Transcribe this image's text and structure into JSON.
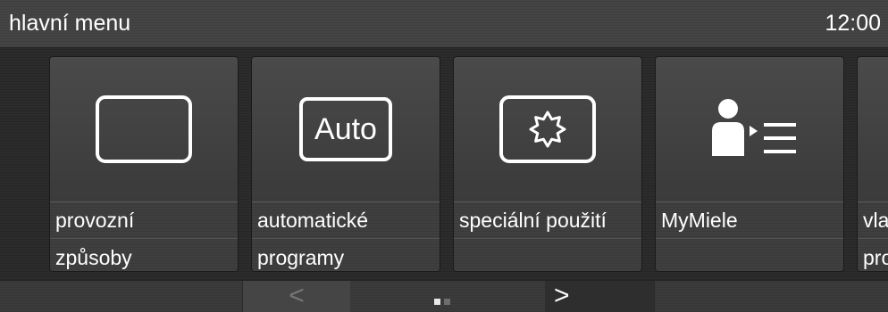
{
  "header": {
    "title": "hlavní menu",
    "clock": "12:00"
  },
  "tiles": [
    {
      "label_line1": "provozní",
      "label_line2": "způsoby",
      "icon": "blank-rectangle-icon"
    },
    {
      "label_line1": "automatické",
      "label_line2": "programy",
      "icon": "auto-icon",
      "icon_text": "Auto"
    },
    {
      "label_line1": "speciální použití",
      "label_line2": "",
      "icon": "starburst-icon"
    },
    {
      "label_line1": "MyMiele",
      "label_line2": "",
      "icon": "user-list-icon"
    },
    {
      "label_line1": "vla",
      "label_line2": "pro",
      "icon": ""
    }
  ],
  "footer": {
    "prev": "<",
    "next": ">",
    "page_current": 1,
    "page_total": 2
  }
}
